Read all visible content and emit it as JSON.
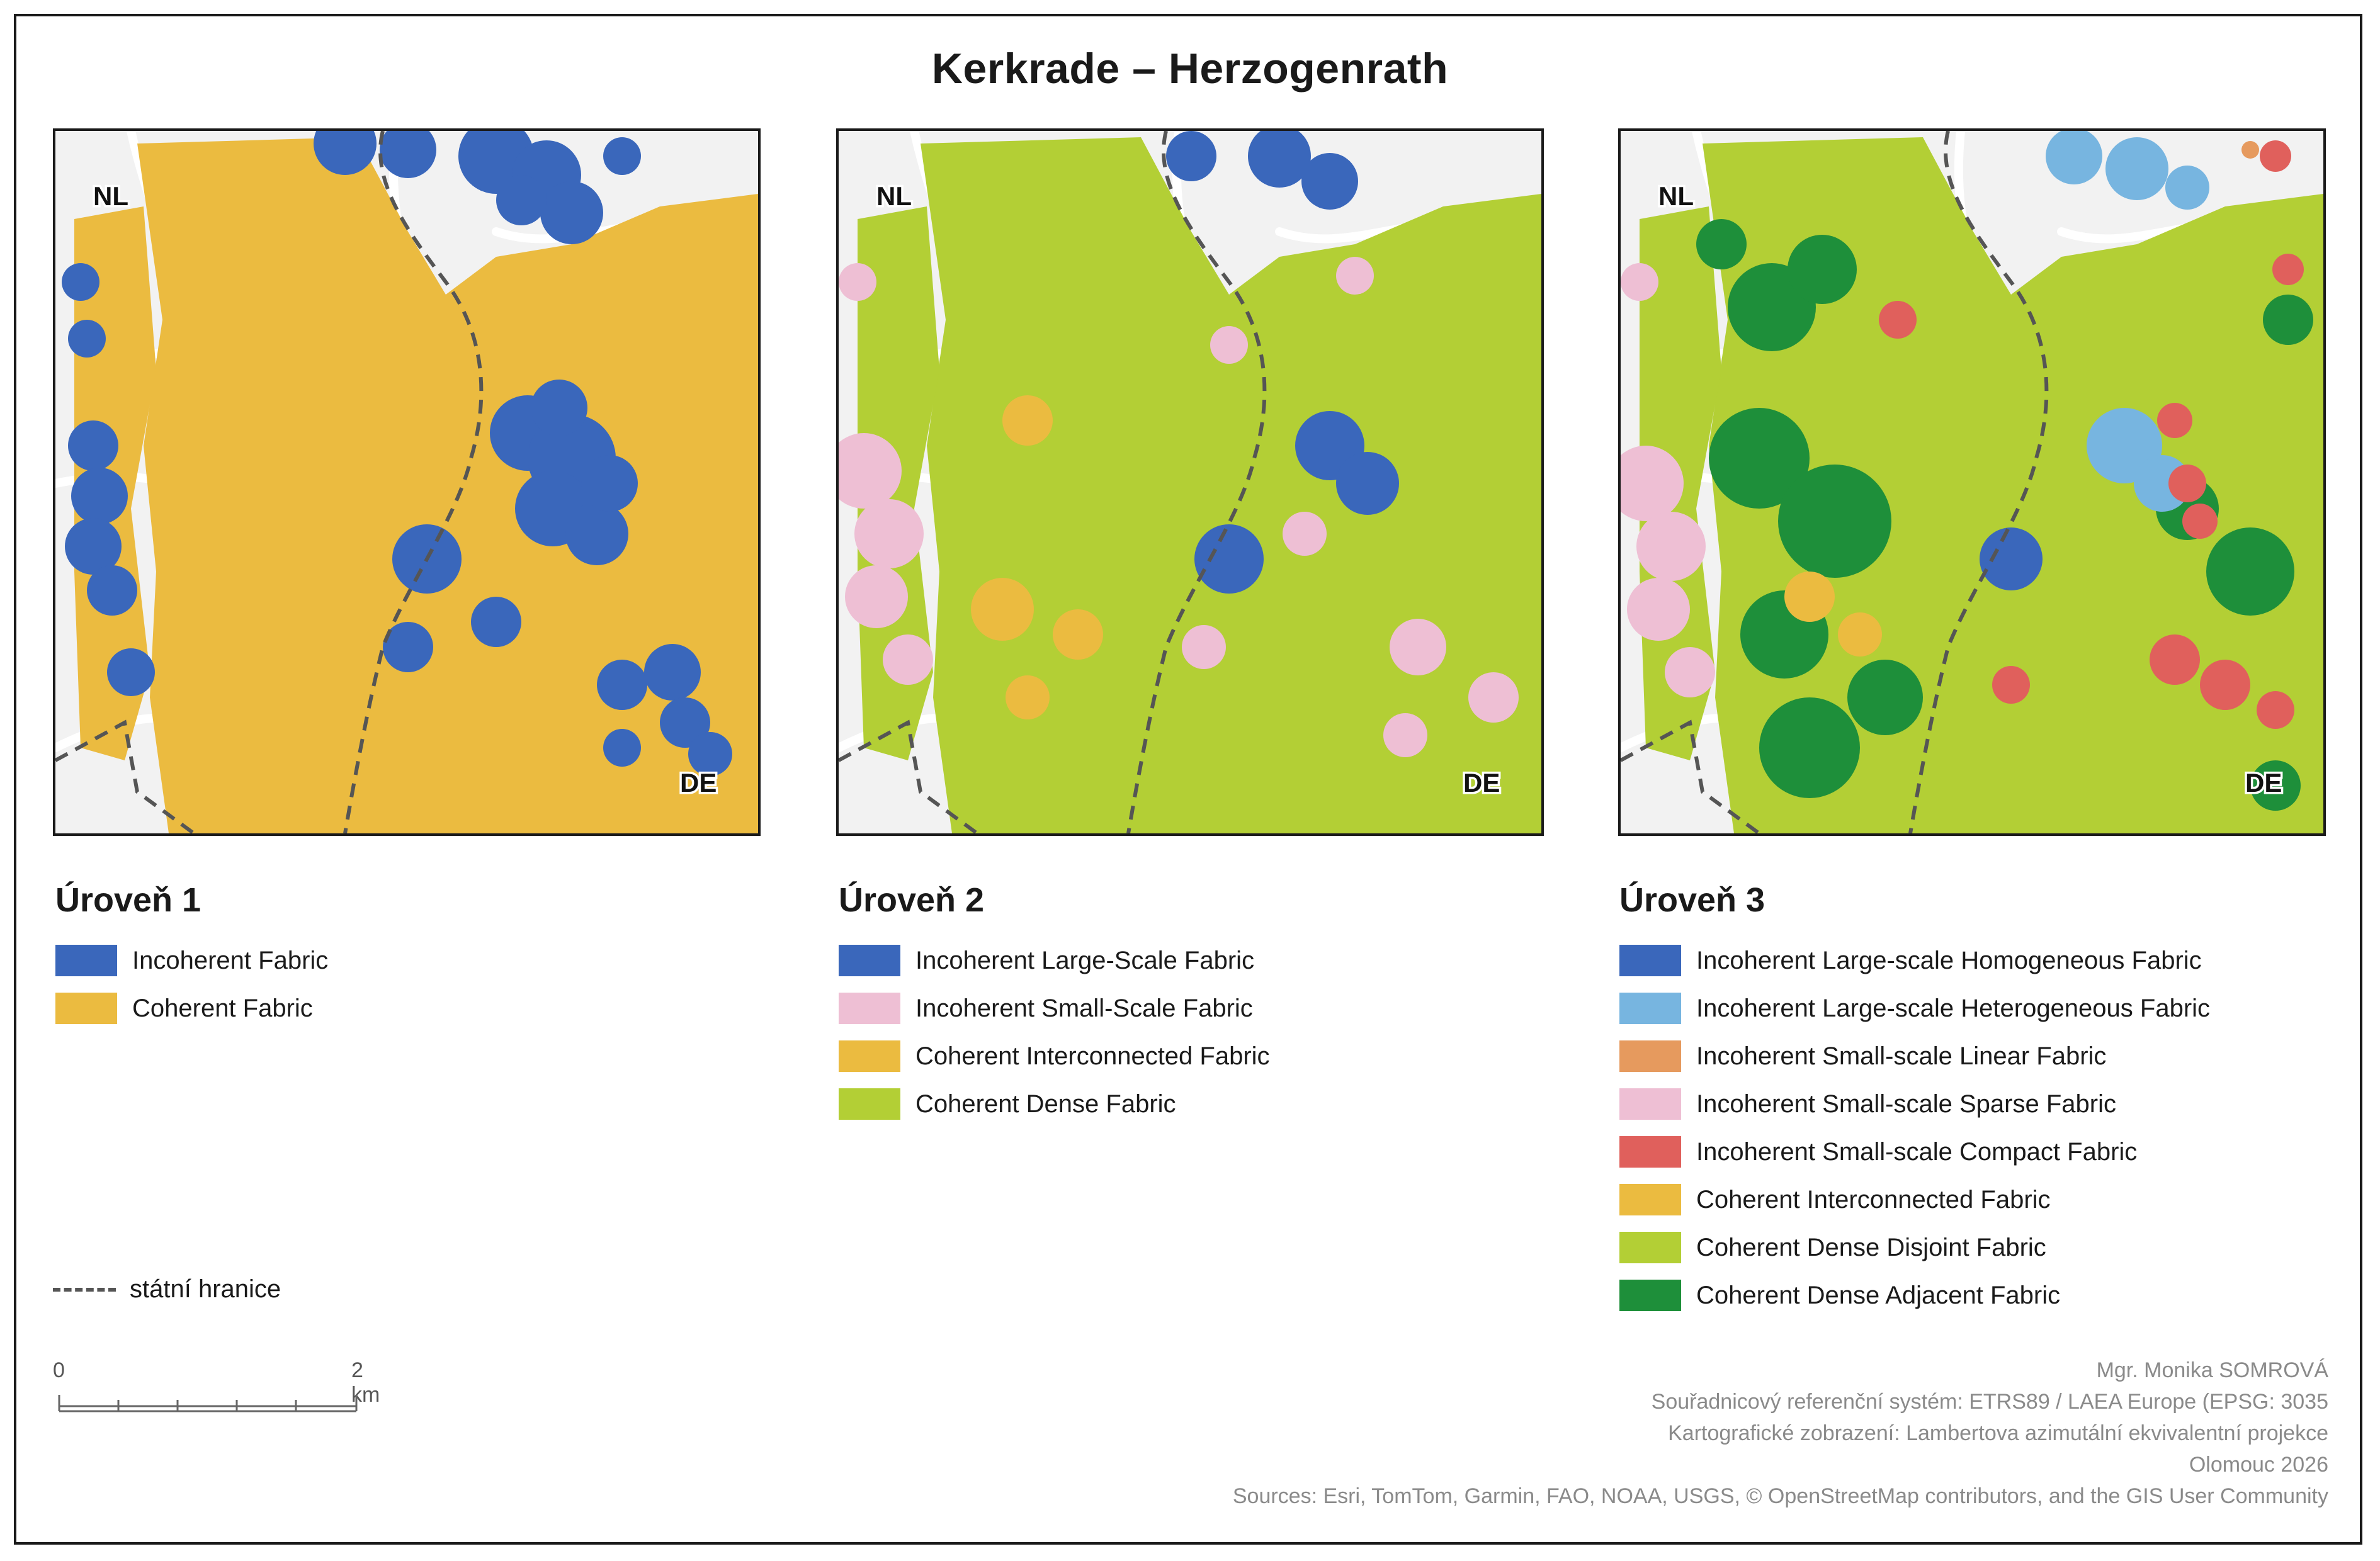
{
  "title": "Kerkrade – Herzogenrath",
  "colors": {
    "incoherent_large_homogeneous": "#3a67bb",
    "incoherent_large_heterogeneous": "#77b5e0",
    "incoherent_small_linear": "#e69a5e",
    "incoherent_small_sparse": "#eebfd4",
    "incoherent_small_compact": "#e0605c",
    "coherent_interconnected": "#ebbb40",
    "coherent_dense_disjoint": "#b3cf35",
    "coherent_dense_adjacent": "#1e8f3a",
    "basemap_land": "#f2f2f2",
    "basemap_roads": "#ffffff",
    "border_line": "#555555"
  },
  "maps": [
    {
      "label_nl": "NL",
      "label_de": "DE",
      "level": 1
    },
    {
      "label_nl": "NL",
      "label_de": "DE",
      "level": 2
    },
    {
      "label_nl": "NL",
      "label_de": "DE",
      "level": 3
    }
  ],
  "legends": [
    {
      "heading": "Úroveň 1",
      "items": [
        {
          "label": "Incoherent Fabric",
          "color": "#3a67bb"
        },
        {
          "label": "Coherent Fabric",
          "color": "#ebbb40"
        }
      ]
    },
    {
      "heading": "Úroveň 2",
      "items": [
        {
          "label": "Incoherent Large-Scale Fabric",
          "color": "#3a67bb"
        },
        {
          "label": "Incoherent Small-Scale Fabric",
          "color": "#eebfd4"
        },
        {
          "label": "Coherent Interconnected Fabric",
          "color": "#ebbb40"
        },
        {
          "label": "Coherent Dense Fabric",
          "color": "#b3cf35"
        }
      ]
    },
    {
      "heading": "Úroveň 3",
      "items": [
        {
          "label": "Incoherent Large-scale Homogeneous Fabric",
          "color": "#3a67bb"
        },
        {
          "label": "Incoherent Large-scale Heterogeneous Fabric",
          "color": "#77b5e0"
        },
        {
          "label": "Incoherent Small-scale Linear Fabric",
          "color": "#e69a5e"
        },
        {
          "label": "Incoherent Small-scale Sparse Fabric",
          "color": "#eebfd4"
        },
        {
          "label": "Incoherent Small-scale Compact Fabric",
          "color": "#e0605c"
        },
        {
          "label": "Coherent Interconnected Fabric",
          "color": "#ebbb40"
        },
        {
          "label": "Coherent Dense Disjoint Fabric",
          "color": "#b3cf35"
        },
        {
          "label": "Coherent Dense Adjacent Fabric",
          "color": "#1e8f3a"
        }
      ]
    }
  ],
  "border_legend": {
    "label": "státní hranice"
  },
  "scalebar": {
    "start": "0",
    "end": "2 km"
  },
  "credits": {
    "author": "Mgr. Monika SOMROVÁ",
    "crs": "Souřadnicový referenční systém: ETRS89 / LAEA Europe (EPSG: 3035",
    "projection": "Kartografické zobrazení: Lambertova azimutální ekvivalentní projekce",
    "place_year": "Olomouc 2026",
    "sources": "Sources: Esri, TomTom, Garmin, FAO, NOAA, USGS, © OpenStreetMap contributors, and the GIS User Community"
  }
}
